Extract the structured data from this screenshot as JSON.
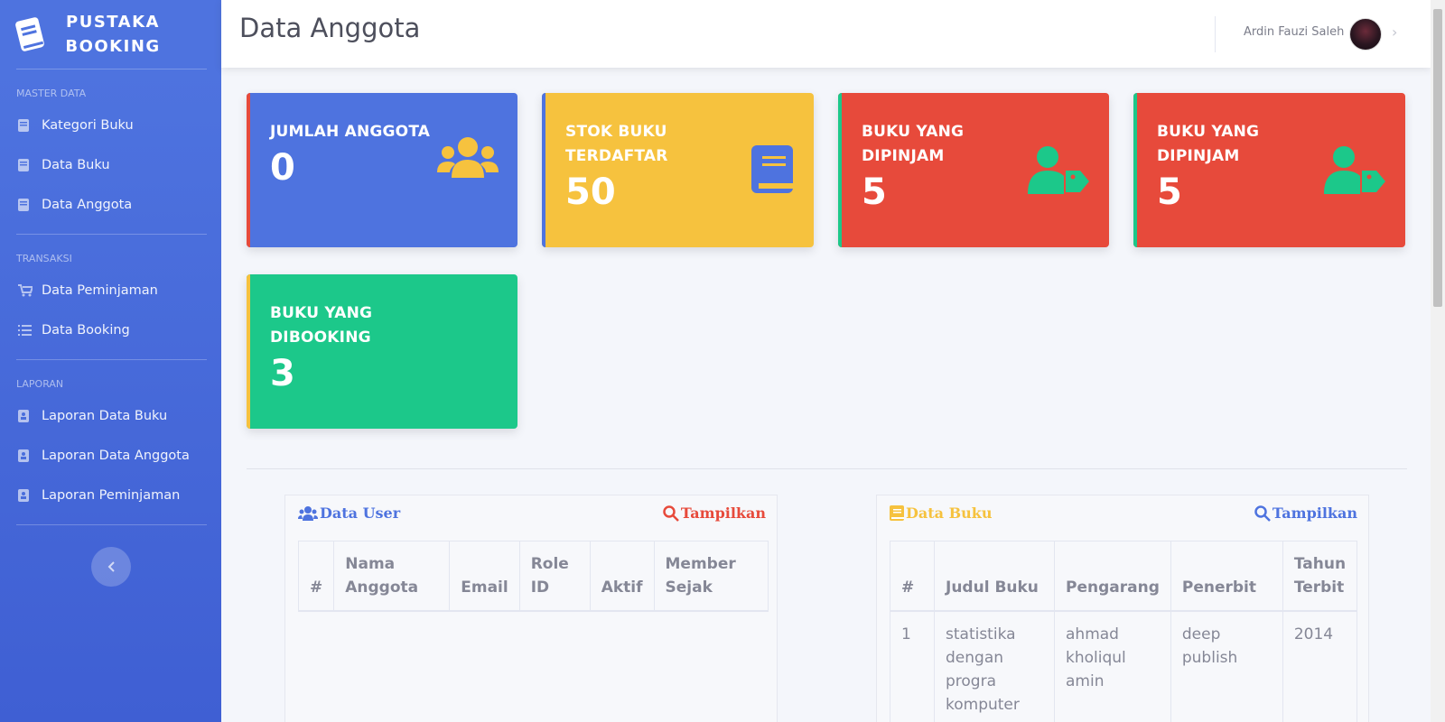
{
  "brand": {
    "name": "PUSTAKA BOOKING"
  },
  "sidebar": {
    "sections": [
      {
        "heading": "MASTER DATA",
        "items": [
          {
            "label": "Kategori Buku",
            "icon": "book-icon"
          },
          {
            "label": "Data Buku",
            "icon": "book-icon"
          },
          {
            "label": "Data Anggota",
            "icon": "book-icon"
          }
        ]
      },
      {
        "heading": "TRANSAKSI",
        "items": [
          {
            "label": "Data Peminjaman",
            "icon": "cart-icon"
          },
          {
            "label": "Data Booking",
            "icon": "list-icon"
          }
        ]
      },
      {
        "heading": "LAPORAN",
        "items": [
          {
            "label": "Laporan Data Buku",
            "icon": "address-book-icon"
          },
          {
            "label": "Laporan Data Anggota",
            "icon": "address-book-icon"
          },
          {
            "label": "Laporan Peminjaman",
            "icon": "address-book-icon"
          }
        ]
      }
    ]
  },
  "topbar": {
    "title": "Data Anggota",
    "user_name": "Ardin Fauzi Saleh"
  },
  "cards": [
    {
      "title": "JUMLAH ANGGOTA",
      "value": "0",
      "color": "#4e73df",
      "stripe": "#e74a3b",
      "icon": "users-icon"
    },
    {
      "title": "STOK BUKU TERDAFTAR",
      "value": "50",
      "color": "#f6c23e",
      "stripe": "#4e73df",
      "icon": "book-icon"
    },
    {
      "title": "BUKU YANG DIPINJAM",
      "value": "5",
      "color": "#e74a3b",
      "stripe": "#1cc88a",
      "icon": "user-tag-icon"
    },
    {
      "title": "BUKU YANG DIPINJAM",
      "value": "5",
      "color": "#e74a3b",
      "stripe": "#1cc88a",
      "icon": "user-tag-icon"
    },
    {
      "title": "BUKU YANG DIBOOKING",
      "value": "3",
      "color": "#1cc88a",
      "stripe": "#f6c23e",
      "icon": ""
    }
  ],
  "user_panel": {
    "title": "Data User",
    "title_color": "#4e73df",
    "action": "Tampilkan",
    "action_color": "#e74a3b",
    "columns": [
      "#",
      "Nama Anggota",
      "Email",
      "Role ID",
      "Aktif",
      "Member Sejak"
    ],
    "rows": []
  },
  "book_panel": {
    "title": "Data Buku",
    "title_color": "#f6c23e",
    "action": "Tampilkan",
    "action_color": "#4e73df",
    "columns": [
      "#",
      "Judul Buku",
      "Pengarang",
      "Penerbit",
      "Tahun Terbit"
    ],
    "rows": [
      [
        "1",
        "statistika dengan progra komputer",
        "ahmad kholiqul amin",
        "deep publish",
        "2014"
      ]
    ]
  }
}
